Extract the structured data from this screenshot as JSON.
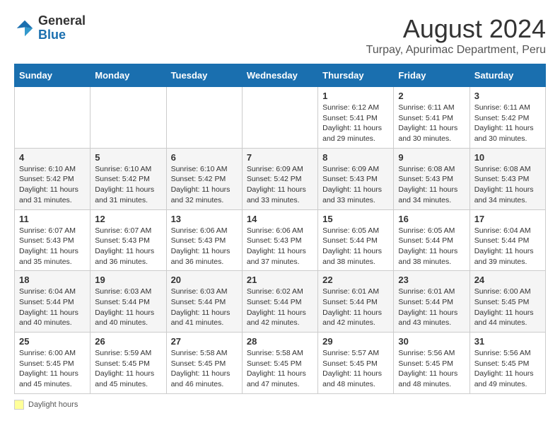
{
  "logo": {
    "general": "General",
    "blue": "Blue"
  },
  "title": {
    "month_year": "August 2024",
    "location": "Turpay, Apurimac Department, Peru"
  },
  "weekdays": [
    "Sunday",
    "Monday",
    "Tuesday",
    "Wednesday",
    "Thursday",
    "Friday",
    "Saturday"
  ],
  "weeks": [
    [
      {
        "day": "",
        "info": ""
      },
      {
        "day": "",
        "info": ""
      },
      {
        "day": "",
        "info": ""
      },
      {
        "day": "",
        "info": ""
      },
      {
        "day": "1",
        "info": "Sunrise: 6:12 AM\nSunset: 5:41 PM\nDaylight: 11 hours and 29 minutes."
      },
      {
        "day": "2",
        "info": "Sunrise: 6:11 AM\nSunset: 5:41 PM\nDaylight: 11 hours and 30 minutes."
      },
      {
        "day": "3",
        "info": "Sunrise: 6:11 AM\nSunset: 5:42 PM\nDaylight: 11 hours and 30 minutes."
      }
    ],
    [
      {
        "day": "4",
        "info": "Sunrise: 6:10 AM\nSunset: 5:42 PM\nDaylight: 11 hours and 31 minutes."
      },
      {
        "day": "5",
        "info": "Sunrise: 6:10 AM\nSunset: 5:42 PM\nDaylight: 11 hours and 31 minutes."
      },
      {
        "day": "6",
        "info": "Sunrise: 6:10 AM\nSunset: 5:42 PM\nDaylight: 11 hours and 32 minutes."
      },
      {
        "day": "7",
        "info": "Sunrise: 6:09 AM\nSunset: 5:42 PM\nDaylight: 11 hours and 33 minutes."
      },
      {
        "day": "8",
        "info": "Sunrise: 6:09 AM\nSunset: 5:43 PM\nDaylight: 11 hours and 33 minutes."
      },
      {
        "day": "9",
        "info": "Sunrise: 6:08 AM\nSunset: 5:43 PM\nDaylight: 11 hours and 34 minutes."
      },
      {
        "day": "10",
        "info": "Sunrise: 6:08 AM\nSunset: 5:43 PM\nDaylight: 11 hours and 34 minutes."
      }
    ],
    [
      {
        "day": "11",
        "info": "Sunrise: 6:07 AM\nSunset: 5:43 PM\nDaylight: 11 hours and 35 minutes."
      },
      {
        "day": "12",
        "info": "Sunrise: 6:07 AM\nSunset: 5:43 PM\nDaylight: 11 hours and 36 minutes."
      },
      {
        "day": "13",
        "info": "Sunrise: 6:06 AM\nSunset: 5:43 PM\nDaylight: 11 hours and 36 minutes."
      },
      {
        "day": "14",
        "info": "Sunrise: 6:06 AM\nSunset: 5:43 PM\nDaylight: 11 hours and 37 minutes."
      },
      {
        "day": "15",
        "info": "Sunrise: 6:05 AM\nSunset: 5:44 PM\nDaylight: 11 hours and 38 minutes."
      },
      {
        "day": "16",
        "info": "Sunrise: 6:05 AM\nSunset: 5:44 PM\nDaylight: 11 hours and 38 minutes."
      },
      {
        "day": "17",
        "info": "Sunrise: 6:04 AM\nSunset: 5:44 PM\nDaylight: 11 hours and 39 minutes."
      }
    ],
    [
      {
        "day": "18",
        "info": "Sunrise: 6:04 AM\nSunset: 5:44 PM\nDaylight: 11 hours and 40 minutes."
      },
      {
        "day": "19",
        "info": "Sunrise: 6:03 AM\nSunset: 5:44 PM\nDaylight: 11 hours and 40 minutes."
      },
      {
        "day": "20",
        "info": "Sunrise: 6:03 AM\nSunset: 5:44 PM\nDaylight: 11 hours and 41 minutes."
      },
      {
        "day": "21",
        "info": "Sunrise: 6:02 AM\nSunset: 5:44 PM\nDaylight: 11 hours and 42 minutes."
      },
      {
        "day": "22",
        "info": "Sunrise: 6:01 AM\nSunset: 5:44 PM\nDaylight: 11 hours and 42 minutes."
      },
      {
        "day": "23",
        "info": "Sunrise: 6:01 AM\nSunset: 5:44 PM\nDaylight: 11 hours and 43 minutes."
      },
      {
        "day": "24",
        "info": "Sunrise: 6:00 AM\nSunset: 5:45 PM\nDaylight: 11 hours and 44 minutes."
      }
    ],
    [
      {
        "day": "25",
        "info": "Sunrise: 6:00 AM\nSunset: 5:45 PM\nDaylight: 11 hours and 45 minutes."
      },
      {
        "day": "26",
        "info": "Sunrise: 5:59 AM\nSunset: 5:45 PM\nDaylight: 11 hours and 45 minutes."
      },
      {
        "day": "27",
        "info": "Sunrise: 5:58 AM\nSunset: 5:45 PM\nDaylight: 11 hours and 46 minutes."
      },
      {
        "day": "28",
        "info": "Sunrise: 5:58 AM\nSunset: 5:45 PM\nDaylight: 11 hours and 47 minutes."
      },
      {
        "day": "29",
        "info": "Sunrise: 5:57 AM\nSunset: 5:45 PM\nDaylight: 11 hours and 48 minutes."
      },
      {
        "day": "30",
        "info": "Sunrise: 5:56 AM\nSunset: 5:45 PM\nDaylight: 11 hours and 48 minutes."
      },
      {
        "day": "31",
        "info": "Sunrise: 5:56 AM\nSunset: 5:45 PM\nDaylight: 11 hours and 49 minutes."
      }
    ]
  ],
  "footer": {
    "swatch_label": "Daylight hours"
  }
}
